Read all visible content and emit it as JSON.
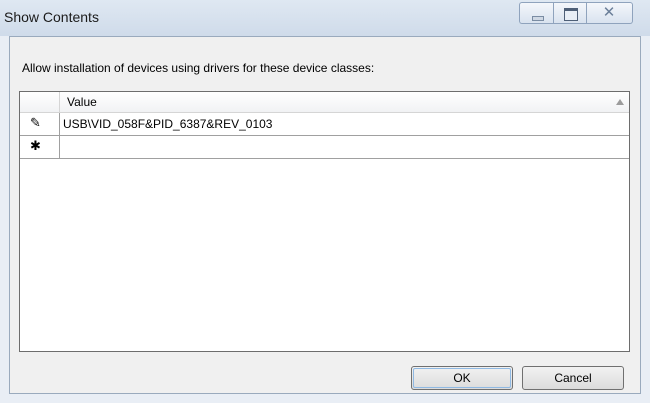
{
  "window": {
    "title": "Show Contents"
  },
  "controls": {
    "minimize_icon": "minimize-icon",
    "maximize_icon": "maximize-icon",
    "close_symbol": "✕"
  },
  "dialog": {
    "prompt": "Allow installation of devices using drivers for these device classes:"
  },
  "grid": {
    "columns": [
      "Value"
    ],
    "rows": [
      {
        "indicator": "✎",
        "indicator_icon": "pencil-icon",
        "value": "USB\\VID_058F&PID_6387&REV_0103"
      },
      {
        "indicator": "✱",
        "indicator_icon": "asterisk-icon",
        "value": ""
      }
    ]
  },
  "buttons": {
    "ok": "OK",
    "cancel": "Cancel"
  }
}
